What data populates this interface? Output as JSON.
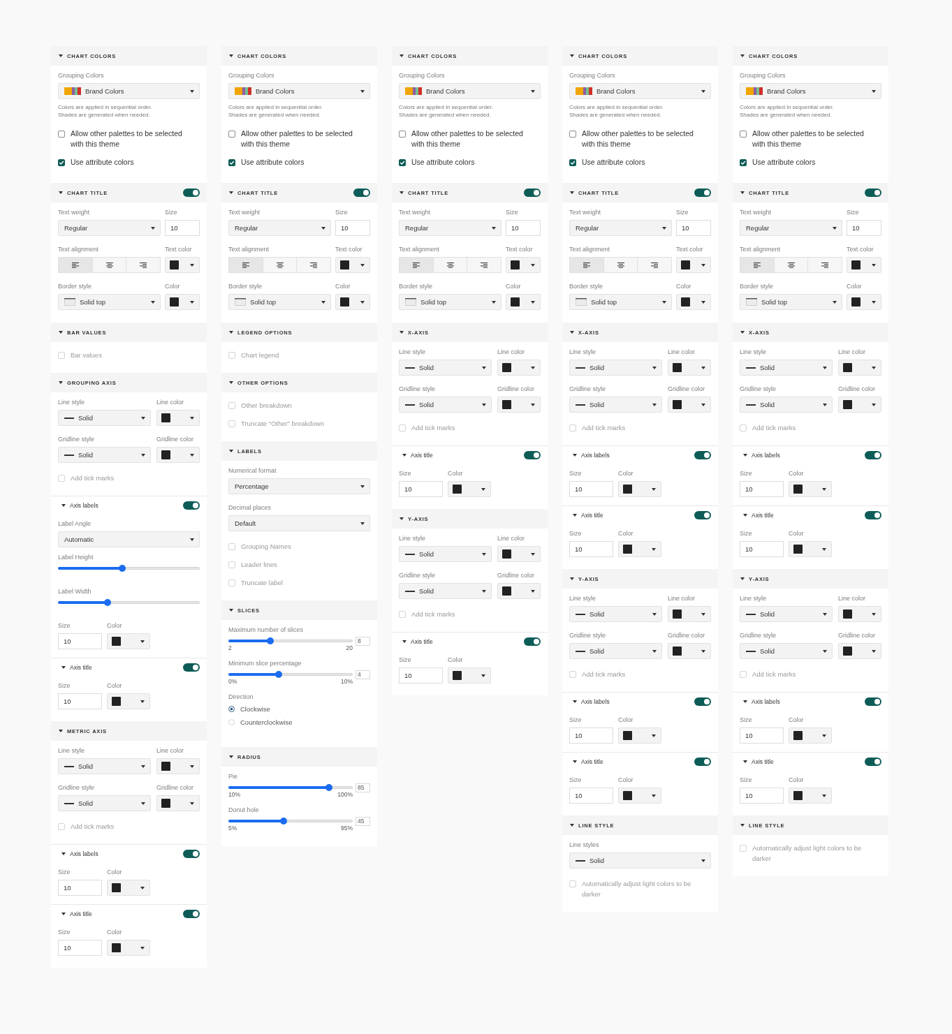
{
  "panels": [
    {
      "sections": [
        {
          "kind": "section",
          "title": "CHART COLORS",
          "expanded": true,
          "rows": [
            {
              "kind": "palette_select",
              "label": "Grouping Colors",
              "value": "Brand Colors"
            },
            {
              "kind": "note",
              "lines": [
                "Colors are applied in sequential order.",
                "Shades are generated when needed."
              ]
            },
            {
              "kind": "checkbox",
              "label": "Allow other palettes to be selected with this theme",
              "checked": false,
              "disabled": false
            },
            {
              "kind": "checkbox",
              "label": "Use attribute colors",
              "checked": true,
              "disabled": false
            }
          ]
        },
        {
          "kind": "section",
          "title": "CHART TITLE",
          "expanded": true,
          "on": true,
          "rows": [
            {
              "kind": "pair",
              "fields": [
                {
                  "kind": "select",
                  "label": "Text weight",
                  "value": "Regular"
                },
                {
                  "kind": "input",
                  "label": "Size",
                  "value": "10"
                }
              ]
            },
            {
              "kind": "pair",
              "fields": [
                {
                  "kind": "align",
                  "label": "Text alignment",
                  "options": [
                    {
                      "kind": "left",
                      "selected": true
                    },
                    {
                      "kind": "center",
                      "selected": false
                    },
                    {
                      "kind": "right",
                      "selected": false
                    }
                  ]
                },
                {
                  "kind": "color",
                  "label": "Text color",
                  "color": "#222222"
                }
              ]
            },
            {
              "kind": "pair",
              "fields": [
                {
                  "kind": "border_select",
                  "label": "Border style",
                  "value": "Solid top"
                },
                {
                  "kind": "color",
                  "label": "Color",
                  "color": "#222222"
                }
              ]
            }
          ]
        },
        {
          "kind": "section",
          "title": "BAR VALUES",
          "expanded": true,
          "rows": [
            {
              "kind": "checkbox",
              "label": "Bar values",
              "checked": false,
              "disabled": true
            }
          ]
        },
        {
          "kind": "section",
          "title": "GROUPING AXIS",
          "expanded": true,
          "rows": [
            {
              "kind": "pair",
              "fields": [
                {
                  "kind": "line_select",
                  "label": "Line style",
                  "value": "Solid"
                },
                {
                  "kind": "color",
                  "label": "Line color",
                  "color": "#222222"
                }
              ]
            },
            {
              "kind": "pair",
              "fields": [
                {
                  "kind": "line_select",
                  "label": "Gridline style",
                  "value": "Solid"
                },
                {
                  "kind": "color",
                  "label": "Gridline color",
                  "color": "#222222"
                }
              ]
            },
            {
              "kind": "checkbox",
              "label": "Add tick marks",
              "checked": false,
              "disabled": true
            }
          ]
        },
        {
          "kind": "subsection",
          "title": "Axis labels",
          "expanded": true,
          "on": true,
          "rows": [
            {
              "kind": "select",
              "label": "Label Angle",
              "value": "Automatic"
            },
            {
              "kind": "slider",
              "label": "Label Height",
              "level": 0.45
            },
            {
              "kind": "slider",
              "label": "Label Width",
              "level": 0.34
            },
            {
              "kind": "pair",
              "fields": [
                {
                  "kind": "input",
                  "label": "Size",
                  "value": "10"
                },
                {
                  "kind": "color",
                  "label": "Color",
                  "color": "#222222"
                }
              ]
            }
          ]
        },
        {
          "kind": "subsection",
          "title": "Axis title",
          "expanded": true,
          "on": true,
          "rows": [
            {
              "kind": "pair",
              "fields": [
                {
                  "kind": "input",
                  "label": "Size",
                  "value": "10"
                },
                {
                  "kind": "color",
                  "label": "Color",
                  "color": "#222222"
                }
              ]
            }
          ]
        },
        {
          "kind": "section",
          "title": "METRIC AXIS",
          "expanded": true,
          "rows": [
            {
              "kind": "pair",
              "fields": [
                {
                  "kind": "line_select",
                  "label": "Line style",
                  "value": "Solid"
                },
                {
                  "kind": "color",
                  "label": "Line color",
                  "color": "#222222"
                }
              ]
            },
            {
              "kind": "pair",
              "fields": [
                {
                  "kind": "line_select",
                  "label": "Gridline style",
                  "value": "Solid"
                },
                {
                  "kind": "color",
                  "label": "Gridline color",
                  "color": "#222222"
                }
              ]
            },
            {
              "kind": "checkbox",
              "label": "Add tick marks",
              "checked": false,
              "disabled": true
            }
          ]
        },
        {
          "kind": "subsection",
          "title": "Axis labels",
          "expanded": true,
          "on": true,
          "rows": [
            {
              "kind": "pair",
              "fields": [
                {
                  "kind": "input",
                  "label": "Size",
                  "value": "10"
                },
                {
                  "kind": "color",
                  "label": "Color",
                  "color": "#222222"
                }
              ]
            }
          ]
        },
        {
          "kind": "subsection",
          "title": "Axis title",
          "expanded": true,
          "on": true,
          "rows": [
            {
              "kind": "pair",
              "fields": [
                {
                  "kind": "input",
                  "label": "Size",
                  "value": "10"
                },
                {
                  "kind": "color",
                  "label": "Color",
                  "color": "#222222"
                }
              ]
            }
          ]
        }
      ]
    },
    {
      "sections": [
        {
          "kind": "section",
          "title": "CHART COLORS",
          "expanded": true,
          "rows": [
            {
              "kind": "palette_select",
              "label": "Grouping Colors",
              "value": "Brand Colors"
            },
            {
              "kind": "note",
              "lines": [
                "Colors are applied in sequential order.",
                "Shades are generated when needed."
              ]
            },
            {
              "kind": "checkbox",
              "label": "Allow other palettes to be selected with this theme",
              "checked": false,
              "disabled": false
            },
            {
              "kind": "checkbox",
              "label": "Use attribute colors",
              "checked": true,
              "disabled": false
            }
          ]
        },
        {
          "kind": "section",
          "title": "CHART TITLE",
          "expanded": true,
          "on": true,
          "rows": [
            {
              "kind": "pair",
              "fields": [
                {
                  "kind": "select",
                  "label": "Text weight",
                  "value": "Regular"
                },
                {
                  "kind": "input",
                  "label": "Size",
                  "value": "10"
                }
              ]
            },
            {
              "kind": "pair",
              "fields": [
                {
                  "kind": "align",
                  "label": "Text alignment",
                  "options": [
                    {
                      "kind": "left",
                      "selected": true
                    },
                    {
                      "kind": "center",
                      "selected": false
                    },
                    {
                      "kind": "right",
                      "selected": false
                    }
                  ]
                },
                {
                  "kind": "color",
                  "label": "Text color",
                  "color": "#222222"
                }
              ]
            },
            {
              "kind": "pair",
              "fields": [
                {
                  "kind": "border_select",
                  "label": "Border style",
                  "value": "Solid top"
                },
                {
                  "kind": "color",
                  "label": "Color",
                  "color": "#222222"
                }
              ]
            }
          ]
        },
        {
          "kind": "section",
          "title": "LEGEND OPTIONS",
          "expanded": true,
          "rows": [
            {
              "kind": "checkbox",
              "label": "Chart legend",
              "checked": false,
              "disabled": true
            }
          ]
        },
        {
          "kind": "section",
          "title": "OTHER OPTIONS",
          "expanded": true,
          "rows": [
            {
              "kind": "checkbox",
              "label": "Other breakdown",
              "checked": false,
              "disabled": true
            },
            {
              "kind": "checkbox",
              "label": "Truncate “Other” breakdown",
              "checked": false,
              "disabled": true
            }
          ]
        },
        {
          "kind": "section",
          "title": "LABELS",
          "expanded": true,
          "rows": [
            {
              "kind": "select",
              "label": "Numerical format",
              "value": "Percentage"
            },
            {
              "kind": "select",
              "label": "Decimal places",
              "value": "Default"
            },
            {
              "kind": "checkbox",
              "label": "Grouping Names",
              "checked": false,
              "disabled": true
            },
            {
              "kind": "checkbox",
              "label": "Leader lines",
              "checked": false,
              "disabled": true
            },
            {
              "kind": "checkbox",
              "label": "Truncate label",
              "checked": false,
              "disabled": true
            }
          ]
        },
        {
          "kind": "section",
          "title": "SLICES",
          "expanded": true,
          "rows": [
            {
              "kind": "slider",
              "label": "Maximum number of slices",
              "level": 0.33,
              "value": "8",
              "min": "2",
              "max": "20"
            },
            {
              "kind": "slider",
              "label": "Minimum slice percentage",
              "level": 0.4,
              "value": "4",
              "min": "0%",
              "max": "10%"
            },
            {
              "kind": "radio",
              "label": "Direction",
              "options": [
                {
                  "label": "Clockwise",
                  "selected": true
                },
                {
                  "label": "Counterclockwise",
                  "selected": false
                }
              ]
            }
          ]
        },
        {
          "kind": "section",
          "title": "RADIUS",
          "expanded": true,
          "rows": [
            {
              "kind": "slider",
              "label": "Pie",
              "level": 0.83,
              "value": "85",
              "min": "10%",
              "max": "100%"
            },
            {
              "kind": "slider",
              "label": "Donut hole",
              "level": 0.44,
              "value": "45",
              "min": "5%",
              "max": "95%"
            }
          ]
        }
      ]
    },
    {
      "sections": [
        {
          "kind": "section",
          "title": "CHART COLORS",
          "expanded": true,
          "rows": [
            {
              "kind": "palette_select",
              "label": "Grouping Colors",
              "value": "Brand Colors"
            },
            {
              "kind": "note",
              "lines": [
                "Colors are applied in sequential order.",
                "Shades are generated when needed."
              ]
            },
            {
              "kind": "checkbox",
              "label": "Allow other palettes to be selected with this theme",
              "checked": false,
              "disabled": false
            },
            {
              "kind": "checkbox",
              "label": "Use attribute colors",
              "checked": true,
              "disabled": false
            }
          ]
        },
        {
          "kind": "section",
          "title": "CHART TITLE",
          "expanded": true,
          "on": true,
          "rows": [
            {
              "kind": "pair",
              "fields": [
                {
                  "kind": "select",
                  "label": "Text weight",
                  "value": "Regular"
                },
                {
                  "kind": "input",
                  "label": "Size",
                  "value": "10"
                }
              ]
            },
            {
              "kind": "pair",
              "fields": [
                {
                  "kind": "align",
                  "label": "Text alignment",
                  "options": [
                    {
                      "kind": "left",
                      "selected": true
                    },
                    {
                      "kind": "center",
                      "selected": false
                    },
                    {
                      "kind": "right",
                      "selected": false
                    }
                  ]
                },
                {
                  "kind": "color",
                  "label": "Text color",
                  "color": "#222222"
                }
              ]
            },
            {
              "kind": "pair",
              "fields": [
                {
                  "kind": "border_select",
                  "label": "Border style",
                  "value": "Solid top"
                },
                {
                  "kind": "color",
                  "label": "Color",
                  "color": "#222222"
                }
              ]
            }
          ]
        },
        {
          "kind": "section",
          "title": "X-AXIS",
          "expanded": true,
          "rows": [
            {
              "kind": "pair",
              "fields": [
                {
                  "kind": "line_select",
                  "label": "Line style",
                  "value": "Solid"
                },
                {
                  "kind": "color",
                  "label": "Line color",
                  "color": "#222222"
                }
              ]
            },
            {
              "kind": "pair",
              "fields": [
                {
                  "kind": "line_select",
                  "label": "Gridline style",
                  "value": "Solid"
                },
                {
                  "kind": "color",
                  "label": "Gridline color",
                  "color": "#222222"
                }
              ]
            },
            {
              "kind": "checkbox",
              "label": "Add tick marks",
              "checked": false,
              "disabled": true
            }
          ]
        },
        {
          "kind": "subsection",
          "title": "Axis title",
          "expanded": true,
          "on": true,
          "rows": [
            {
              "kind": "pair",
              "fields": [
                {
                  "kind": "input",
                  "label": "Size",
                  "value": "10"
                },
                {
                  "kind": "color",
                  "label": "Color",
                  "color": "#222222"
                }
              ]
            }
          ]
        },
        {
          "kind": "section",
          "title": "Y-AXIS",
          "expanded": true,
          "rows": [
            {
              "kind": "pair",
              "fields": [
                {
                  "kind": "line_select",
                  "label": "Line style",
                  "value": "Solid"
                },
                {
                  "kind": "color",
                  "label": "Line color",
                  "color": "#222222"
                }
              ]
            },
            {
              "kind": "pair",
              "fields": [
                {
                  "kind": "line_select",
                  "label": "Gridline style",
                  "value": "Solid"
                },
                {
                  "kind": "color",
                  "label": "Gridline color",
                  "color": "#222222"
                }
              ]
            },
            {
              "kind": "checkbox",
              "label": "Add tick marks",
              "checked": false,
              "disabled": true
            }
          ]
        },
        {
          "kind": "subsection",
          "title": "Axis title",
          "expanded": true,
          "on": true,
          "rows": [
            {
              "kind": "pair",
              "fields": [
                {
                  "kind": "input",
                  "label": "Size",
                  "value": "10"
                },
                {
                  "kind": "color",
                  "label": "Color",
                  "color": "#222222"
                }
              ]
            }
          ]
        }
      ]
    },
    {
      "sections": [
        {
          "kind": "section",
          "title": "CHART COLORS",
          "expanded": true,
          "rows": [
            {
              "kind": "palette_select",
              "label": "Grouping Colors",
              "value": "Brand Colors"
            },
            {
              "kind": "note",
              "lines": [
                "Colors are applied in sequential order.",
                "Shades are generated when needed."
              ]
            },
            {
              "kind": "checkbox",
              "label": "Allow other palettes to be selected with this theme",
              "checked": false,
              "disabled": false
            },
            {
              "kind": "checkbox",
              "label": "Use attribute colors",
              "checked": true,
              "disabled": false
            }
          ]
        },
        {
          "kind": "section",
          "title": "CHART TITLE",
          "expanded": true,
          "on": true,
          "rows": [
            {
              "kind": "pair",
              "fields": [
                {
                  "kind": "select",
                  "label": "Text weight",
                  "value": "Regular"
                },
                {
                  "kind": "input",
                  "label": "Size",
                  "value": "10"
                }
              ]
            },
            {
              "kind": "pair",
              "fields": [
                {
                  "kind": "align",
                  "label": "Text alignment",
                  "options": [
                    {
                      "kind": "left",
                      "selected": true
                    },
                    {
                      "kind": "center",
                      "selected": false
                    },
                    {
                      "kind": "right",
                      "selected": false
                    }
                  ]
                },
                {
                  "kind": "color",
                  "label": "Text color",
                  "color": "#222222"
                }
              ]
            },
            {
              "kind": "pair",
              "fields": [
                {
                  "kind": "border_select",
                  "label": "Border style",
                  "value": "Solid top"
                },
                {
                  "kind": "color",
                  "label": "Color",
                  "color": "#222222"
                }
              ]
            }
          ]
        },
        {
          "kind": "section",
          "title": "X-AXIS",
          "expanded": true,
          "rows": [
            {
              "kind": "pair",
              "fields": [
                {
                  "kind": "line_select",
                  "label": "Line style",
                  "value": "Solid"
                },
                {
                  "kind": "color",
                  "label": "Line color",
                  "color": "#222222"
                }
              ]
            },
            {
              "kind": "pair",
              "fields": [
                {
                  "kind": "line_select",
                  "label": "Gridline style",
                  "value": "Solid"
                },
                {
                  "kind": "color",
                  "label": "Gridline color",
                  "color": "#222222"
                }
              ]
            },
            {
              "kind": "checkbox",
              "label": "Add tick marks",
              "checked": false,
              "disabled": true
            }
          ]
        },
        {
          "kind": "subsection",
          "title": "Axis labels",
          "expanded": true,
          "on": true,
          "rows": [
            {
              "kind": "pair",
              "fields": [
                {
                  "kind": "input",
                  "label": "Size",
                  "value": "10"
                },
                {
                  "kind": "color",
                  "label": "Color",
                  "color": "#222222"
                }
              ]
            }
          ]
        },
        {
          "kind": "subsection",
          "title": "Axis title",
          "expanded": true,
          "on": true,
          "rows": [
            {
              "kind": "pair",
              "fields": [
                {
                  "kind": "input",
                  "label": "Size",
                  "value": "10"
                },
                {
                  "kind": "color",
                  "label": "Color",
                  "color": "#222222"
                }
              ]
            }
          ]
        },
        {
          "kind": "section",
          "title": "Y-AXIS",
          "expanded": true,
          "rows": [
            {
              "kind": "pair",
              "fields": [
                {
                  "kind": "line_select",
                  "label": "Line style",
                  "value": "Solid"
                },
                {
                  "kind": "color",
                  "label": "Line color",
                  "color": "#222222"
                }
              ]
            },
            {
              "kind": "pair",
              "fields": [
                {
                  "kind": "line_select",
                  "label": "Gridline style",
                  "value": "Solid"
                },
                {
                  "kind": "color",
                  "label": "Gridline color",
                  "color": "#222222"
                }
              ]
            },
            {
              "kind": "checkbox",
              "label": "Add tick marks",
              "checked": false,
              "disabled": true
            }
          ]
        },
        {
          "kind": "subsection",
          "title": "Axis labels",
          "expanded": true,
          "on": true,
          "rows": [
            {
              "kind": "pair",
              "fields": [
                {
                  "kind": "input",
                  "label": "Size",
                  "value": "10"
                },
                {
                  "kind": "color",
                  "label": "Color",
                  "color": "#222222"
                }
              ]
            }
          ]
        },
        {
          "kind": "subsection",
          "title": "Axis title",
          "expanded": true,
          "on": true,
          "rows": [
            {
              "kind": "pair",
              "fields": [
                {
                  "kind": "input",
                  "label": "Size",
                  "value": "10"
                },
                {
                  "kind": "color",
                  "label": "Color",
                  "color": "#222222"
                }
              ]
            }
          ]
        },
        {
          "kind": "section",
          "title": "LINE STYLE",
          "expanded": true,
          "rows": [
            {
              "kind": "line_select",
              "label": "Line styles",
              "value": "Solid"
            },
            {
              "kind": "checkbox",
              "label": "Automatically adjust light colors to be darker",
              "checked": false,
              "disabled": true
            }
          ]
        }
      ]
    },
    {
      "sections": [
        {
          "kind": "section",
          "title": "CHART COLORS",
          "expanded": true,
          "rows": [
            {
              "kind": "palette_select",
              "label": "Grouping Colors",
              "value": "Brand Colors"
            },
            {
              "kind": "note",
              "lines": [
                "Colors are applied in sequential order.",
                "Shades are generated when needed."
              ]
            },
            {
              "kind": "checkbox",
              "label": "Allow other palettes to be selected with this theme",
              "checked": false,
              "disabled": false
            },
            {
              "kind": "checkbox",
              "label": "Use attribute colors",
              "checked": true,
              "disabled": false
            }
          ]
        },
        {
          "kind": "section",
          "title": "CHART TITLE",
          "expanded": true,
          "on": true,
          "rows": [
            {
              "kind": "pair",
              "fields": [
                {
                  "kind": "select",
                  "label": "Text weight",
                  "value": "Regular"
                },
                {
                  "kind": "input",
                  "label": "Size",
                  "value": "10"
                }
              ]
            },
            {
              "kind": "pair",
              "fields": [
                {
                  "kind": "align",
                  "label": "Text alignment",
                  "options": [
                    {
                      "kind": "left",
                      "selected": true
                    },
                    {
                      "kind": "center",
                      "selected": false
                    },
                    {
                      "kind": "right",
                      "selected": false
                    }
                  ]
                },
                {
                  "kind": "color",
                  "label": "Text color",
                  "color": "#222222"
                }
              ]
            },
            {
              "kind": "pair",
              "fields": [
                {
                  "kind": "border_select",
                  "label": "Border style",
                  "value": "Solid top"
                },
                {
                  "kind": "color",
                  "label": "Color",
                  "color": "#222222"
                }
              ]
            }
          ]
        },
        {
          "kind": "section",
          "title": "X-AXIS",
          "expanded": true,
          "rows": [
            {
              "kind": "pair",
              "fields": [
                {
                  "kind": "line_select",
                  "label": "Line style",
                  "value": "Solid"
                },
                {
                  "kind": "color",
                  "label": "Line color",
                  "color": "#222222"
                }
              ]
            },
            {
              "kind": "pair",
              "fields": [
                {
                  "kind": "line_select",
                  "label": "Gridline style",
                  "value": "Solid"
                },
                {
                  "kind": "color",
                  "label": "Gridline color",
                  "color": "#222222"
                }
              ]
            },
            {
              "kind": "checkbox",
              "label": "Add tick marks",
              "checked": false,
              "disabled": true
            }
          ]
        },
        {
          "kind": "subsection",
          "title": "Axis labels",
          "expanded": true,
          "on": true,
          "rows": [
            {
              "kind": "pair",
              "fields": [
                {
                  "kind": "input",
                  "label": "Size",
                  "value": "10"
                },
                {
                  "kind": "color",
                  "label": "Color",
                  "color": "#222222"
                }
              ]
            }
          ]
        },
        {
          "kind": "subsection",
          "title": "Axis title",
          "expanded": true,
          "on": true,
          "rows": [
            {
              "kind": "pair",
              "fields": [
                {
                  "kind": "input",
                  "label": "Size",
                  "value": "10"
                },
                {
                  "kind": "color",
                  "label": "Color",
                  "color": "#222222"
                }
              ]
            }
          ]
        },
        {
          "kind": "section",
          "title": "Y-AXIS",
          "expanded": true,
          "rows": [
            {
              "kind": "pair",
              "fields": [
                {
                  "kind": "line_select",
                  "label": "Line style",
                  "value": "Solid"
                },
                {
                  "kind": "color",
                  "label": "Line color",
                  "color": "#222222"
                }
              ]
            },
            {
              "kind": "pair",
              "fields": [
                {
                  "kind": "line_select",
                  "label": "Gridline style",
                  "value": "Solid"
                },
                {
                  "kind": "color",
                  "label": "Gridline color",
                  "color": "#222222"
                }
              ]
            },
            {
              "kind": "checkbox",
              "label": "Add tick marks",
              "checked": false,
              "disabled": true
            }
          ]
        },
        {
          "kind": "subsection",
          "title": "Axis labels",
          "expanded": true,
          "on": true,
          "rows": [
            {
              "kind": "pair",
              "fields": [
                {
                  "kind": "input",
                  "label": "Size",
                  "value": "10"
                },
                {
                  "kind": "color",
                  "label": "Color",
                  "color": "#222222"
                }
              ]
            }
          ]
        },
        {
          "kind": "subsection",
          "title": "Axis title",
          "expanded": true,
          "on": true,
          "rows": [
            {
              "kind": "pair",
              "fields": [
                {
                  "kind": "input",
                  "label": "Size",
                  "value": "10"
                },
                {
                  "kind": "color",
                  "label": "Color",
                  "color": "#222222"
                }
              ]
            }
          ]
        },
        {
          "kind": "section",
          "title": "LINE STYLE",
          "expanded": true,
          "rows": [
            {
              "kind": "checkbox",
              "label": "Automatically adjust light colors to be darker",
              "checked": false,
              "disabled": true
            }
          ]
        }
      ]
    }
  ]
}
